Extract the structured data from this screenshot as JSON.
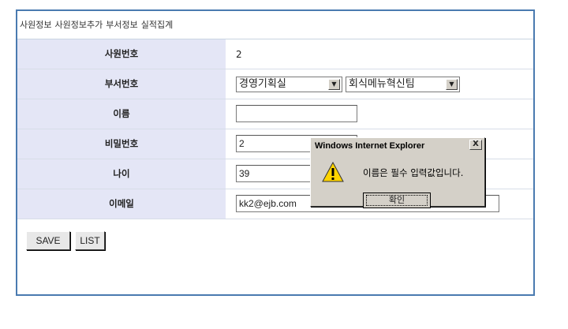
{
  "nav": {
    "items": [
      "사원정보",
      "사원정보추가",
      "부서정보",
      "실적집계"
    ]
  },
  "form": {
    "rows": [
      {
        "label": "사원번호",
        "value": "2"
      },
      {
        "label": "부서번호",
        "select1": "경영기획실",
        "select2": "회식메뉴혁신팀"
      },
      {
        "label": "이름",
        "value": ""
      },
      {
        "label": "비밀번호",
        "value": "2"
      },
      {
        "label": "나이",
        "value": "39"
      },
      {
        "label": "이메일",
        "value": "kk2@ejb.com"
      }
    ]
  },
  "buttons": {
    "save": "SAVE",
    "list": "LIST"
  },
  "dialog": {
    "title": "Windows Internet Explorer",
    "close": "X",
    "message": "이름은 필수 입력값입니다.",
    "ok": "확인",
    "icon": "warning-icon"
  },
  "colors": {
    "frame_border": "#4a7ab0",
    "label_bg": "#e4e6f6",
    "dialog_bg": "#d4d0c8"
  }
}
